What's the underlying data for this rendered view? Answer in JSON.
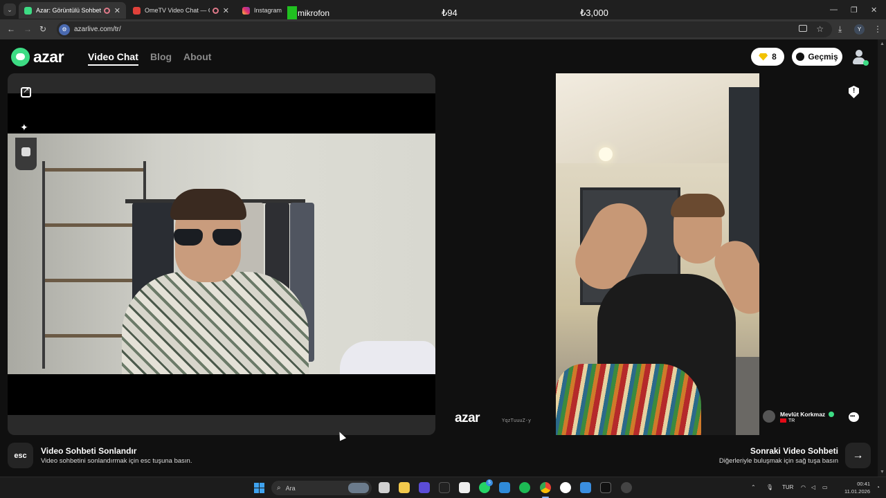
{
  "browser": {
    "tabs": [
      {
        "label": "Azar: Görüntülü Sohbet & V",
        "active": true,
        "recording": true
      },
      {
        "label": "OmeTV Video Chat — Ome",
        "active": false,
        "recording": true
      },
      {
        "label": "Instagram",
        "active": false,
        "recording": false
      }
    ],
    "overlay": {
      "mic_label": "mikrofon",
      "price_1": "₺94",
      "price_2": "₺3,000"
    },
    "url": "azarlive.com/tr/",
    "profile_initial": "Y"
  },
  "header": {
    "logo_text": "azar",
    "nav": [
      {
        "label": "Video Chat",
        "active": true
      },
      {
        "label": "Blog",
        "active": false
      },
      {
        "label": "About",
        "active": false
      }
    ],
    "gems_count": "8",
    "history_label": "Geçmiş"
  },
  "remote": {
    "watermark": "azar",
    "watermark_id": "YqzTuuuZ-y",
    "peer_name": "Mevlüt Korkmaz",
    "peer_country": "TR",
    "report_symbol": "!",
    "chat_symbol": "•••"
  },
  "controls": {
    "end_key": "esc",
    "end_title": "Video Sohbeti Sonlandır",
    "end_subtitle": "Video sohbetini sonlandırmak için esc tuşuna basın.",
    "next_title": "Sonraki Video Sohbeti",
    "next_subtitle": "Diğerleriyle buluşmak için sağ tuşa basın",
    "next_symbol": "→"
  },
  "taskbar": {
    "search_placeholder": "Ara",
    "whatsapp_badge": "5",
    "language": "TUR",
    "time": "00:41",
    "date": "11.01.2026"
  },
  "colors": {
    "accent": "#3ddc84",
    "gem": "#f2c200",
    "background": "#101010",
    "panel": "#2a2a2a"
  }
}
